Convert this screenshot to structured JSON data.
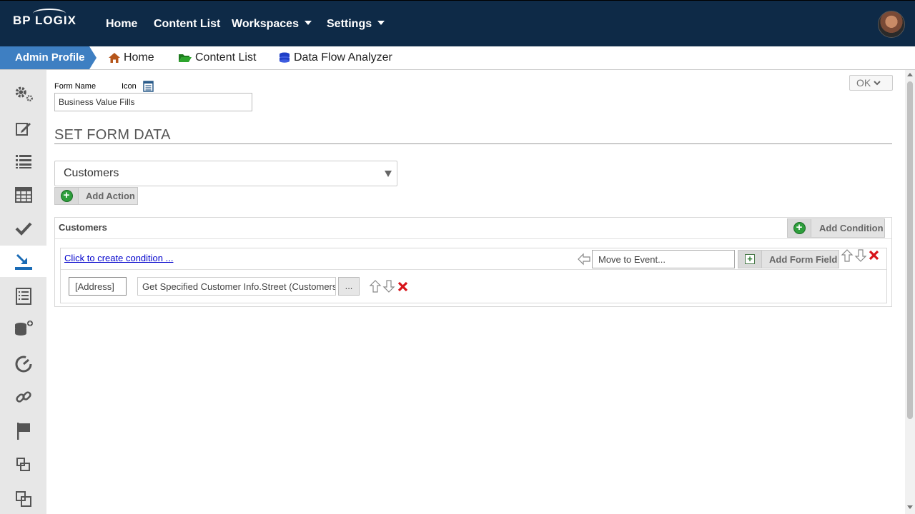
{
  "brand": {
    "logo_text": "BP LOGIX"
  },
  "topnav": {
    "home": "Home",
    "content_list": "Content List",
    "workspaces": "Workspaces",
    "settings": "Settings"
  },
  "breadcrumb": {
    "admin_profile": "Admin Profile",
    "home": "Home",
    "content_list": "Content List",
    "data_flow_analyzer": "Data Flow Analyzer"
  },
  "sidebar": {
    "items": [
      "gears-icon",
      "edit-icon",
      "list-icon",
      "table-icon",
      "check-icon",
      "download-tray-icon",
      "document-list-icon",
      "database-add-icon",
      "dashboard-icon",
      "link-icon",
      "flag-icon",
      "window-icon",
      "windows-icon"
    ],
    "active_index": 5
  },
  "form": {
    "form_name_label": "Form Name",
    "icon_label": "Icon",
    "form_name_value": "Business Value Fills",
    "ok_label": "OK"
  },
  "section": {
    "title": "SET FORM DATA",
    "select_value": "Customers",
    "add_action_label": "Add Action"
  },
  "panel": {
    "title": "Customers",
    "add_condition_label": "Add Condition",
    "condition_link": "Click to create condition ...",
    "move_event_placeholder": "Move to Event...",
    "add_form_field_label": "Add Form Field",
    "field_name": "[Address]",
    "field_expression": "Get Specified Customer Info.Street (Customers)",
    "dots_label": "..."
  },
  "colors": {
    "topnav_bg": "#0e2a47",
    "admin_profile_bg": "#3e7fc2",
    "sidebar_bg": "#e7e7e7",
    "accent_green": "#2e9e3c",
    "delete_red": "#d7141a"
  }
}
